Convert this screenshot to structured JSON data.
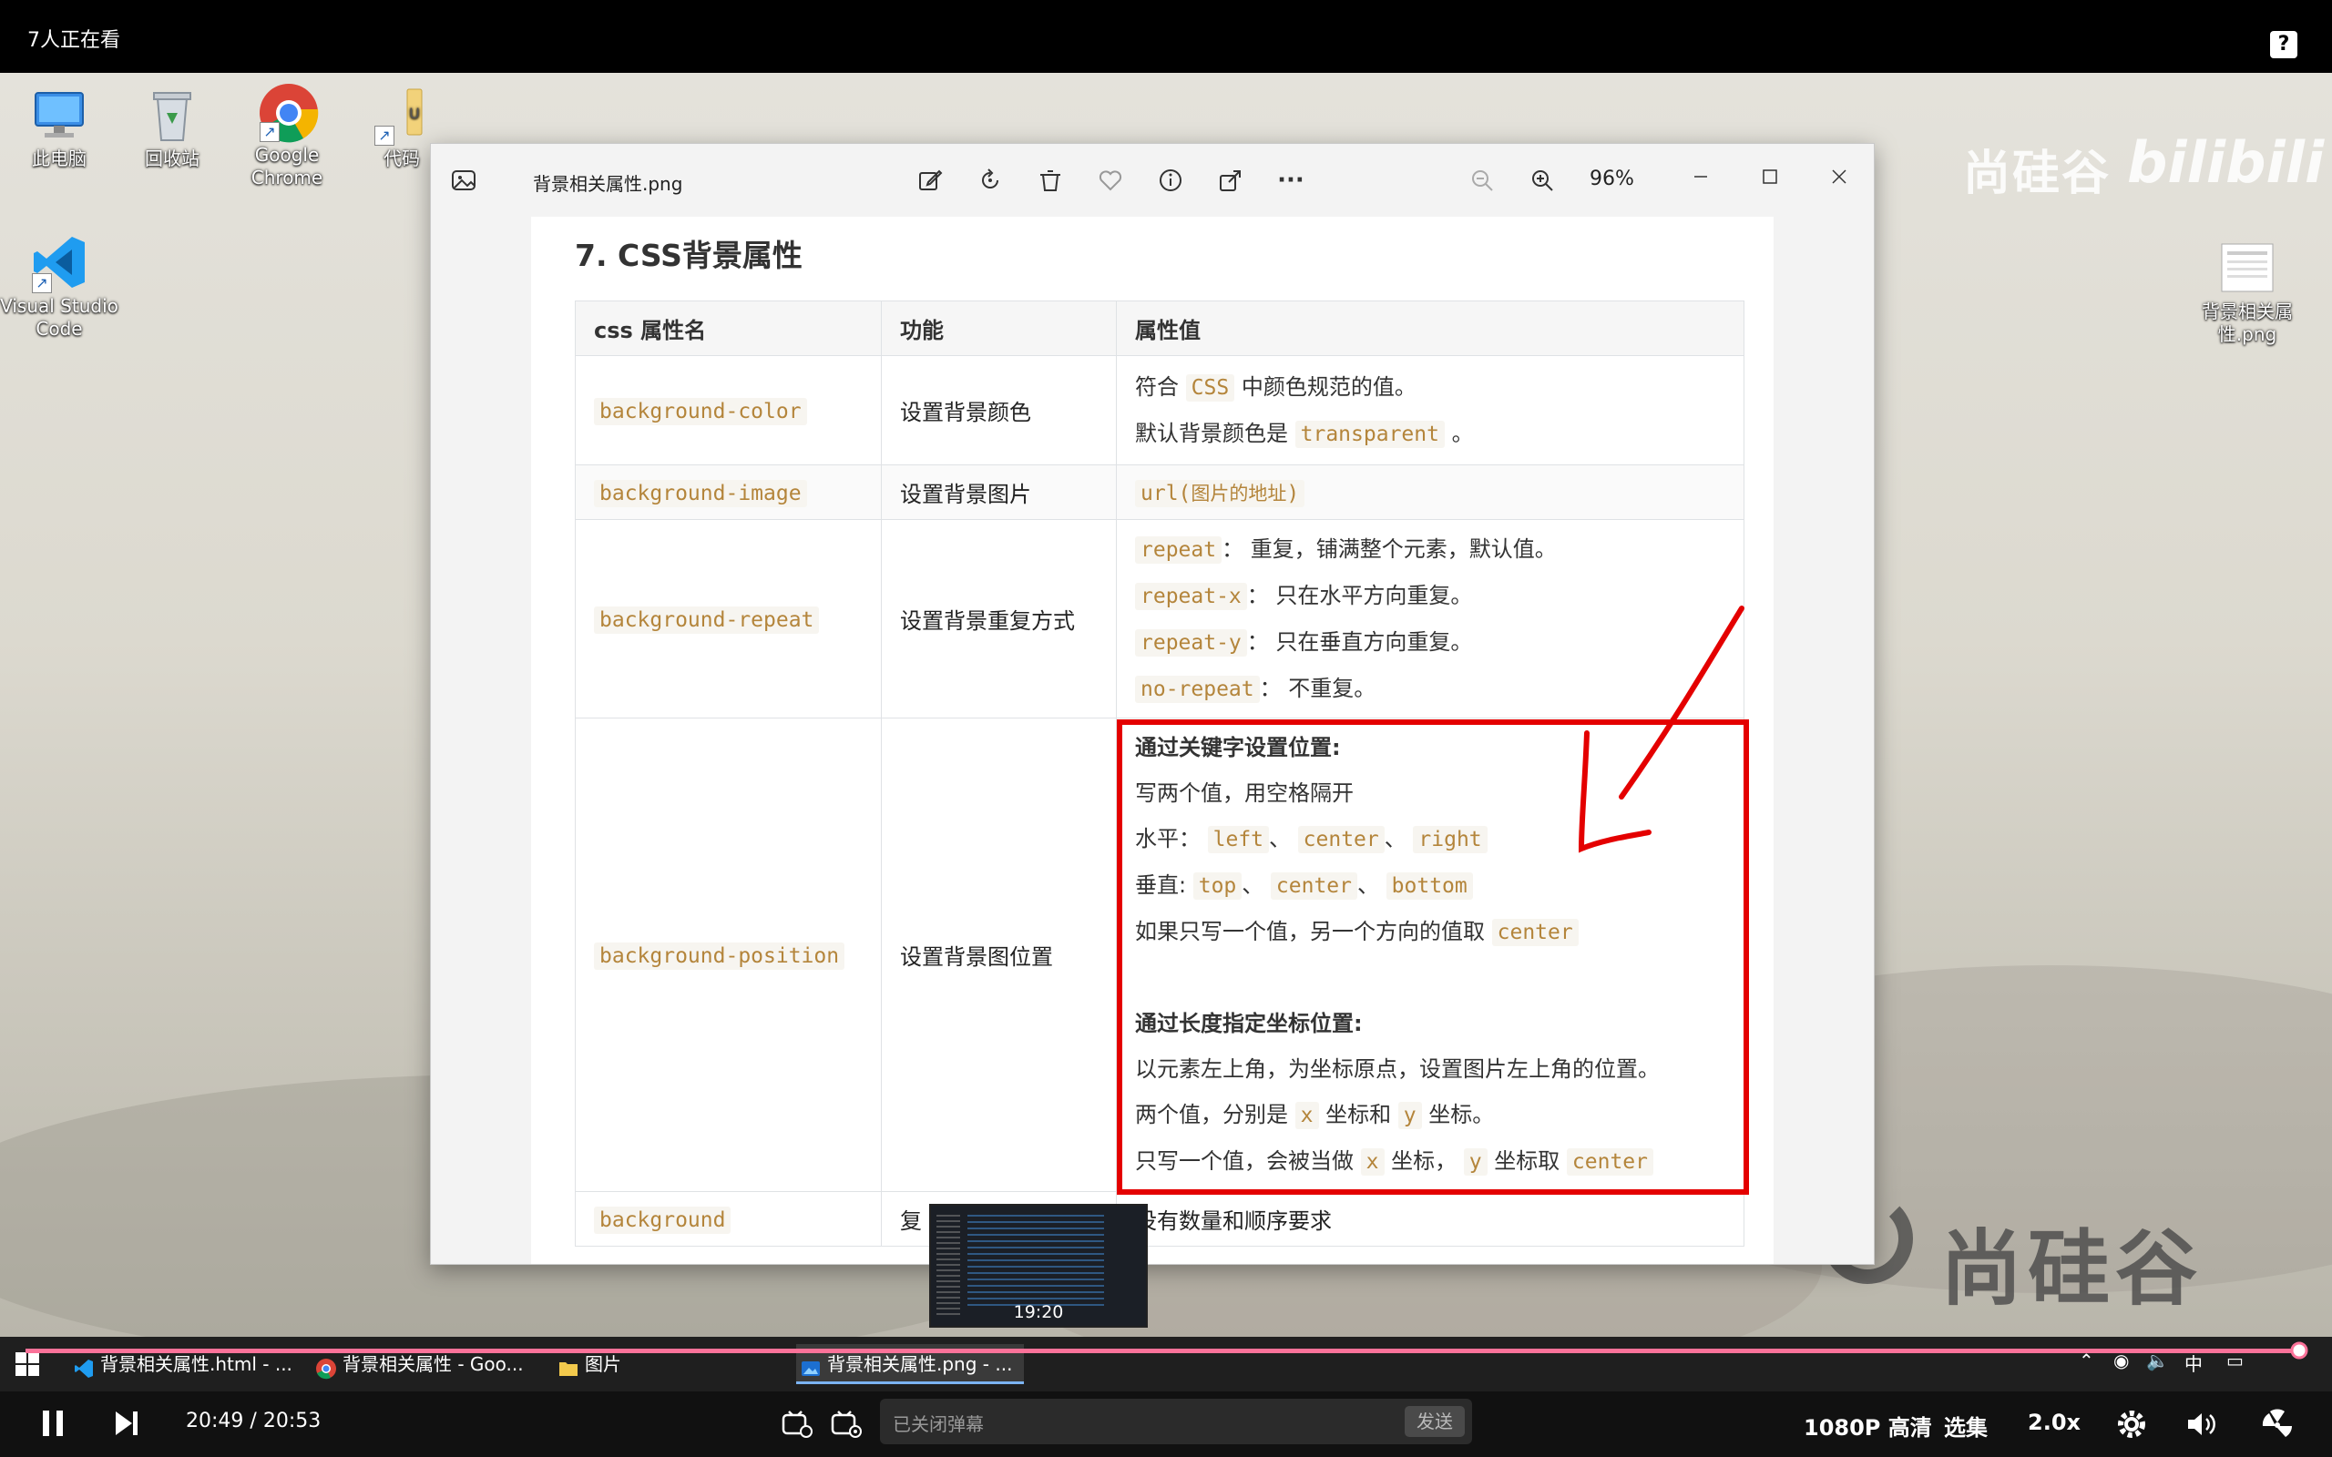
{
  "topbar": {
    "viewers": "7人正在看",
    "help": "?"
  },
  "desktop_icons": [
    {
      "label": "此电脑"
    },
    {
      "label": "回收站"
    },
    {
      "label": "Google Chrome"
    },
    {
      "label": "代码"
    },
    {
      "label": "Visual Studio Code"
    },
    {
      "label": "背景相关属性.png"
    }
  ],
  "watermark": {
    "brand_top": "尚硅谷",
    "bili": "bilibili",
    "brand_bottom": "尚硅谷"
  },
  "viewer": {
    "filename": "背景相关属性.png",
    "zoom": "96%",
    "toolbar_icons": [
      "edit-icon",
      "rotate-icon",
      "delete-icon",
      "favorite-icon",
      "info-icon",
      "share-icon",
      "more-icon"
    ],
    "more": "···"
  },
  "document": {
    "heading": "7. CSS背景属性",
    "headers": [
      "css 属性名",
      "功能",
      "属性值"
    ],
    "rows": [
      {
        "name": "background-color",
        "func": "设置背景颜色"
      },
      {
        "name": "background-image",
        "func": "设置背景图片"
      },
      {
        "name": "background-repeat",
        "func": "设置背景重复方式"
      },
      {
        "name": "background-position",
        "func": "设置背景图位置"
      },
      {
        "name": "background",
        "func": "复"
      }
    ],
    "color": {
      "l1_pre": "符合",
      "l1_code": "CSS",
      "l1_post": "中颜色规范的值。",
      "l2_pre": "默认背景颜色是",
      "l2_code": "transparent",
      "l2_post": "。"
    },
    "image": {
      "pre": "url(",
      "cn": "图片的地址",
      "post": ")"
    },
    "repeat": [
      {
        "code": "repeat",
        "text": "： 重复，铺满整个元素，默认值。"
      },
      {
        "code": "repeat-x",
        "text": "： 只在水平方向重复。"
      },
      {
        "code": "repeat-y",
        "text": "： 只在垂直方向重复。"
      },
      {
        "code": "no-repeat",
        "text": "： 不重复。"
      }
    ],
    "position": {
      "kw_title": "通过关键字设置位置:",
      "kw_l1": "写两个值，用空格隔开",
      "h_label": "水平：",
      "h_vals": [
        "left",
        "center",
        "right"
      ],
      "v_label": "垂直:",
      "v_vals": [
        "top",
        "center",
        "bottom"
      ],
      "sep": "、",
      "single_pre": "如果只写一个值，另一个方向的值取",
      "single_code": "center",
      "len_title": "通过长度指定坐标位置:",
      "len_l1": "以元素左上角，为坐标原点，设置图片左上角的位置。",
      "len_l2_a": "两个值，分别是",
      "len_l2_x": "x",
      "len_l2_b": "坐标和",
      "len_l2_y": "y",
      "len_l2_c": "坐标。",
      "len_l3_a": "只写一个值，会被当做",
      "len_l3_x": "x",
      "len_l3_b": "坐标，",
      "len_l3_y": "y",
      "len_l3_c": "坐标取",
      "len_l3_code": "center"
    },
    "bg_value": "没有数量和顺序要求"
  },
  "preview": {
    "time": "19:20"
  },
  "taskbar": {
    "items": [
      {
        "label": "背景相关属性.html - ..."
      },
      {
        "label": "背景相关属性 - Goo..."
      },
      {
        "label": "图片"
      },
      {
        "label": "背景相关属性.png - ..."
      }
    ],
    "tray": {
      "ime": "中"
    }
  },
  "player": {
    "progress_fraction": 0.9968,
    "current": "20:49",
    "slash": "/",
    "total": "20:53",
    "danmaku_placeholder": "已关闭弹幕",
    "send": "发送",
    "quality": "1080P 高清",
    "episodes": "选集",
    "speed": "2.0x"
  }
}
